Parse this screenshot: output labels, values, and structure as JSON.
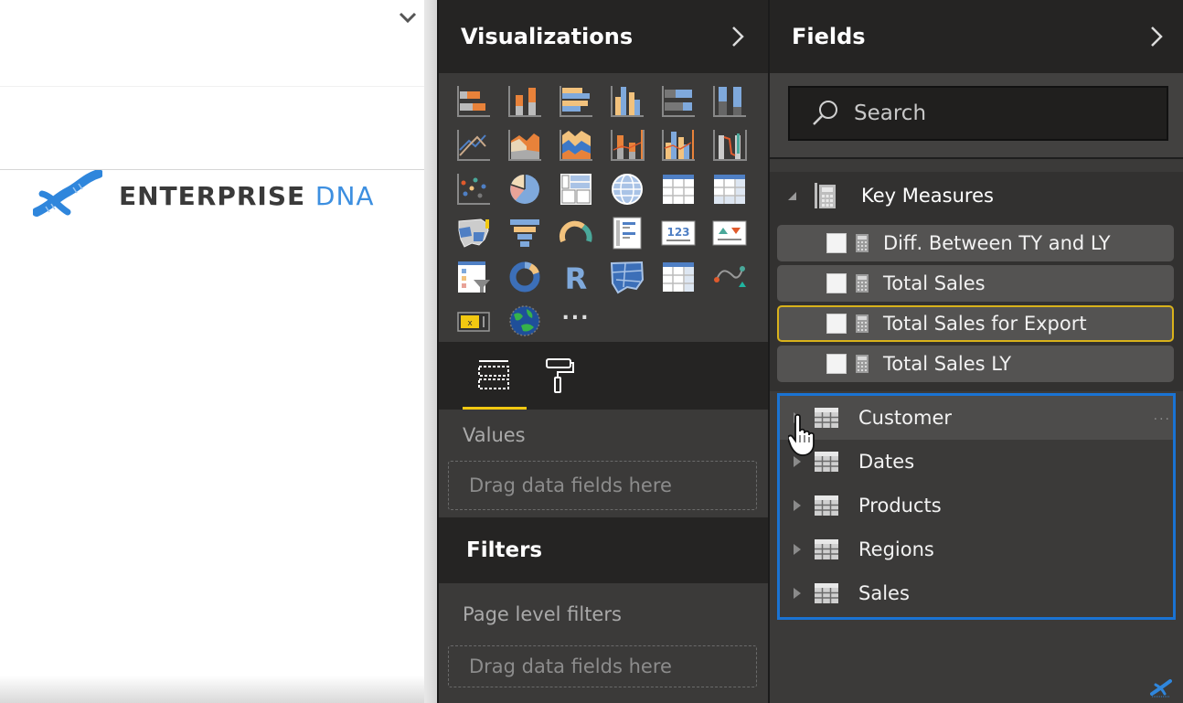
{
  "canvas": {
    "logo": {
      "word1": "ENTERPRISE",
      "word2": "DNA",
      "brand_color": "#3d8fe0"
    },
    "dropdown_icon": "chevron-down-icon"
  },
  "visualizations": {
    "title": "Visualizations",
    "collapse_icon": "chevron-right-icon",
    "icons": [
      "stacked-bar-chart",
      "stacked-column-chart",
      "clustered-bar-chart",
      "clustered-column-chart",
      "100-percent-stacked-bar-chart",
      "100-percent-stacked-column-chart",
      "line-chart",
      "area-chart",
      "stacked-area-chart",
      "line-and-stacked-column-chart",
      "line-and-clustered-column-chart",
      "ribbon-chart",
      "scatter-chart",
      "pie-chart",
      "treemap",
      "map",
      "table",
      "matrix",
      "filled-map",
      "funnel",
      "gauge",
      "multi-row-card",
      "card",
      "kpi",
      "slicer",
      "donut-chart",
      "r-script-visual",
      "shape-map",
      "table-custom",
      "waterfall-custom",
      "custom-visual-yellow",
      "globe-map",
      "more-visuals"
    ],
    "more_label": "...",
    "card_label": "123",
    "r_label": "R",
    "tabs": [
      {
        "name": "fields-tab",
        "active": true
      },
      {
        "name": "format-tab",
        "active": false
      }
    ],
    "values_label": "Values",
    "values_drop": "Drag data fields here",
    "filters_title": "Filters",
    "page_filters_label": "Page level filters",
    "filters_drop": "Drag data fields here",
    "accent_color": "#f2c811"
  },
  "fields": {
    "title": "Fields",
    "collapse_icon": "chevron-right-icon",
    "search": {
      "placeholder": "Search",
      "value": ""
    },
    "groups": [
      {
        "label": "Key Measures",
        "expanded": true,
        "measures": [
          {
            "label": "Diff. Between TY and LY",
            "checked": false,
            "highlighted": false
          },
          {
            "label": "Total Sales",
            "checked": false,
            "highlighted": false
          },
          {
            "label": "Total Sales for Export",
            "checked": false,
            "highlighted": true
          },
          {
            "label": "Total Sales LY",
            "checked": false,
            "highlighted": false
          }
        ]
      }
    ],
    "tables": [
      {
        "label": "Customer",
        "hover": true
      },
      {
        "label": "Dates",
        "hover": false
      },
      {
        "label": "Products",
        "hover": false
      },
      {
        "label": "Regions",
        "hover": false
      },
      {
        "label": "Sales",
        "hover": false
      }
    ],
    "more_dots": "...",
    "selection_color": "#1a73d3",
    "highlight_color": "#d9b21b"
  }
}
